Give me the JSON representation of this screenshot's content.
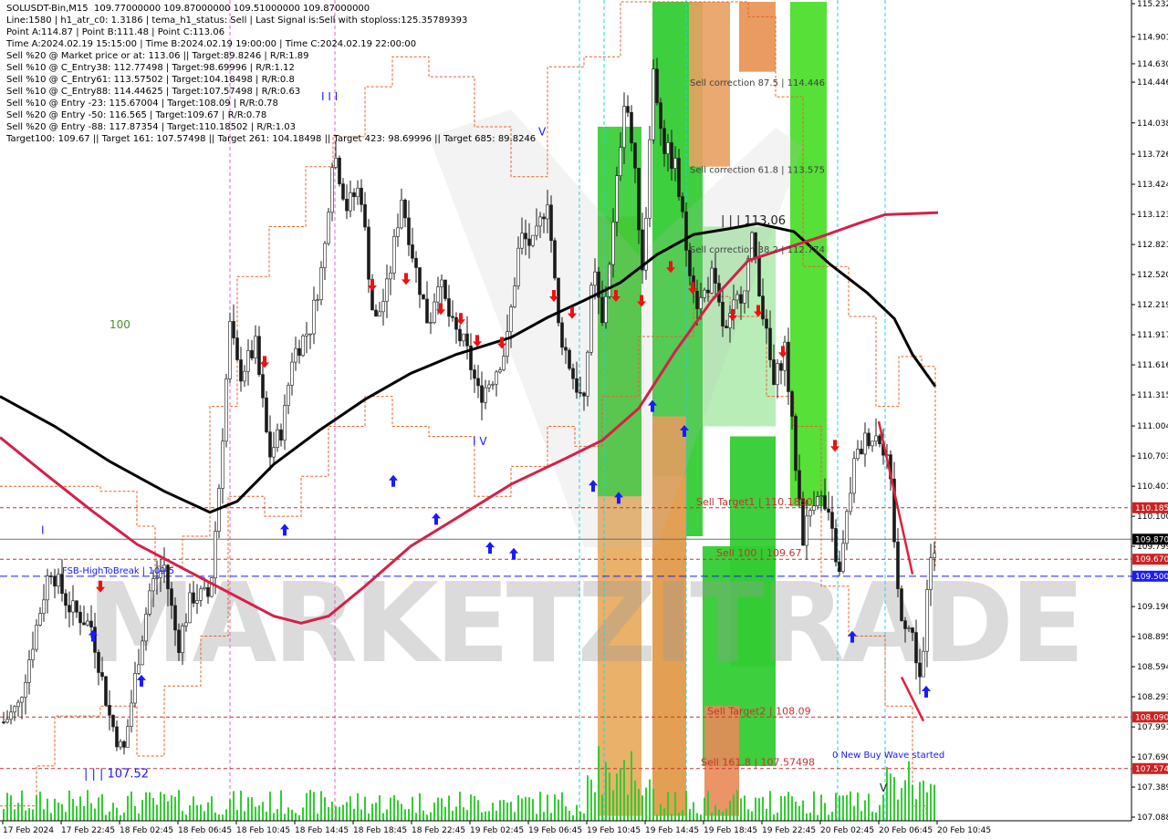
{
  "header": {
    "title": "SOLUSDT-Bin,M15  109.77000000 109.87000000 109.51000000 109.87000000",
    "lines": [
      "Line:1580 | h1_atr_c0: 1.3186 | tema_h1_status: Sell | Last Signal is:Sell with stoploss:125.35789393",
      "Point A:114.87 | Point B:111.48 | Point C:113.06",
      "Time A:2024.02.19 15:15:00 | Time B:2024.02.19 19:00:00 | Time C:2024.02.19 22:00:00",
      "Sell %20 @ Market price or at: 113.06 || Target:89.8246 | R/R:1.89",
      "Sell %10 @ C_Entry38: 112.77498 | Target:98.69996 | R/R:1.12",
      "Sell %10 @ C_Entry61: 113.57502 | Target:104.18498 | R/R:0.8",
      "Sell %10 @ C_Entry88: 114.44625 | Target:107.57498 | R/R:0.63",
      "Sell %10 @ Entry -23: 115.67004 | Target:108.09 | R/R:0.78",
      "Sell %20 @ Entry -50: 116.565 | Target:109.67 | R/R:0.78",
      "Sell %20 @ Entry -88: 117.87354 | Target:110.18502 | R/R:1.03",
      "Target100: 109.67 || Target 161: 107.57498 || Target 261: 104.18498 || Target 423: 98.69996 || Target 685: 89.8246"
    ]
  },
  "watermark": "MARKETZITRADE",
  "chart_data": {
    "type": "candlestick",
    "symbol": "SOLUSDT-Bin",
    "timeframe": "M15",
    "ylim": [
      107.0,
      115.25
    ],
    "price_ticks": [
      "115.232",
      "114.901",
      "114.630",
      "114.446",
      "114.038",
      "113.726",
      "113.424",
      "113.123",
      "112.821",
      "112.520",
      "112.219",
      "111.917",
      "111.616",
      "111.315",
      "111.004",
      "110.703",
      "110.401",
      "110.100",
      "109.799",
      "109.498",
      "109.196",
      "108.895",
      "108.594",
      "108.293",
      "107.991",
      "107.690",
      "107.389",
      "107.088"
    ],
    "x_ticks": [
      "17 Feb 2024",
      "17 Feb 22:45",
      "18 Feb 02:45",
      "18 Feb 06:45",
      "18 Feb 10:45",
      "18 Feb 14:45",
      "18 Feb 18:45",
      "18 Feb 22:45",
      "19 Feb 02:45",
      "19 Feb 06:45",
      "19 Feb 10:45",
      "19 Feb 14:45",
      "19 Feb 18:45",
      "19 Feb 22:45",
      "20 Feb 02:45",
      "20 Feb 06:45",
      "20 Feb 10:45"
    ],
    "current_price": "109.870",
    "price_badges": [
      {
        "label": "110.185",
        "value": 110.185,
        "color": "#cc2222"
      },
      {
        "label": "109.870",
        "value": 109.87,
        "color": "#000000"
      },
      {
        "label": "109.670",
        "value": 109.67,
        "color": "#cc2222"
      },
      {
        "label": "109.500",
        "value": 109.5,
        "color": "#1a1aff"
      },
      {
        "label": "108.090",
        "value": 108.09,
        "color": "#cc2222"
      },
      {
        "label": "107.574",
        "value": 107.574,
        "color": "#cc2222"
      }
    ],
    "levels": [
      {
        "label": "Sell Target1 | 110.1850",
        "value": 110.185,
        "color": "#c83232"
      },
      {
        "label": "Sell 100 | 109.67",
        "value": 109.67,
        "color": "#c83232"
      },
      {
        "label": "FSB-HighToBreak | 109.5",
        "value": 109.5,
        "color": "#1a1aff"
      },
      {
        "label": "Sell Target2 | 108.09",
        "value": 108.09,
        "color": "#c83232"
      },
      {
        "label": "Sell 161.8 | 107.57498",
        "value": 107.57498,
        "color": "#c83232"
      }
    ],
    "annotations": [
      {
        "text": "Sell correction 87.5 | 114.446",
        "value": 114.446
      },
      {
        "text": "Sell correction 61.8 | 113.575",
        "value": 113.575
      },
      {
        "text": "Sell correction 38.2 | 112.774",
        "value": 112.774
      },
      {
        "text": "| | | 113.06",
        "value": 113.06
      },
      {
        "text": "| | | 107.52",
        "value": 107.52
      },
      {
        "text": "0 New Buy Wave started",
        "value": 107.72
      },
      {
        "text": "100",
        "value": 112.02
      },
      {
        "text": "I I I",
        "value": 114.3
      },
      {
        "text": "V",
        "value": 113.95
      },
      {
        "text": "I V",
        "value": 110.85
      },
      {
        "text": "V",
        "value": 107.38
      },
      {
        "text": "I",
        "value": 109.96
      }
    ],
    "ma_black": [
      [
        0,
        111.3
      ],
      [
        60,
        111.0
      ],
      [
        120,
        110.65
      ],
      [
        180,
        110.35
      ],
      [
        230,
        110.14
      ],
      [
        260,
        110.25
      ],
      [
        300,
        110.62
      ],
      [
        350,
        110.96
      ],
      [
        400,
        111.27
      ],
      [
        450,
        111.53
      ],
      [
        500,
        111.72
      ],
      [
        560,
        111.89
      ],
      [
        600,
        112.09
      ],
      [
        640,
        112.26
      ],
      [
        680,
        112.44
      ],
      [
        720,
        112.72
      ],
      [
        760,
        112.92
      ],
      [
        800,
        112.98
      ],
      [
        830,
        113.03
      ],
      [
        870,
        112.95
      ],
      [
        910,
        112.62
      ],
      [
        950,
        112.34
      ],
      [
        980,
        112.08
      ],
      [
        1000,
        111.72
      ],
      [
        1025,
        111.4
      ]
    ],
    "ma_red": [
      [
        0,
        110.89
      ],
      [
        50,
        110.52
      ],
      [
        100,
        110.16
      ],
      [
        150,
        109.82
      ],
      [
        200,
        109.58
      ],
      [
        250,
        109.34
      ],
      [
        300,
        109.1
      ],
      [
        330,
        109.03
      ],
      [
        360,
        109.1
      ],
      [
        400,
        109.4
      ],
      [
        450,
        109.8
      ],
      [
        500,
        110.08
      ],
      [
        560,
        110.42
      ],
      [
        620,
        110.68
      ],
      [
        660,
        110.86
      ],
      [
        700,
        111.18
      ],
      [
        740,
        111.75
      ],
      [
        780,
        112.26
      ],
      [
        820,
        112.66
      ],
      [
        860,
        112.78
      ],
      [
        900,
        112.9
      ],
      [
        940,
        113.03
      ],
      [
        970,
        113.12
      ],
      [
        1000,
        113.13
      ],
      [
        1028,
        113.14
      ]
    ],
    "buy_arrows": [
      [
        102,
        108.9
      ],
      [
        155,
        108.45
      ],
      [
        312,
        109.96
      ],
      [
        431,
        110.45
      ],
      [
        478,
        110.07
      ],
      [
        537,
        109.78
      ],
      [
        563,
        109.72
      ],
      [
        650,
        110.4
      ],
      [
        678,
        110.28
      ],
      [
        715,
        111.2
      ],
      [
        750,
        110.95
      ],
      [
        934,
        108.89
      ],
      [
        1015,
        108.34
      ]
    ],
    "sell_arrows": [
      [
        110,
        109.4
      ],
      [
        290,
        111.65
      ],
      [
        408,
        112.42
      ],
      [
        445,
        112.48
      ],
      [
        483,
        112.18
      ],
      [
        505,
        112.08
      ],
      [
        523,
        111.86
      ],
      [
        550,
        111.84
      ],
      [
        607,
        112.31
      ],
      [
        627,
        112.14
      ],
      [
        675,
        112.31
      ],
      [
        703,
        112.26
      ],
      [
        735,
        112.6
      ],
      [
        759,
        112.39
      ],
      [
        803,
        112.12
      ],
      [
        831,
        112.16
      ],
      [
        858,
        111.75
      ],
      [
        915,
        110.81
      ]
    ]
  }
}
